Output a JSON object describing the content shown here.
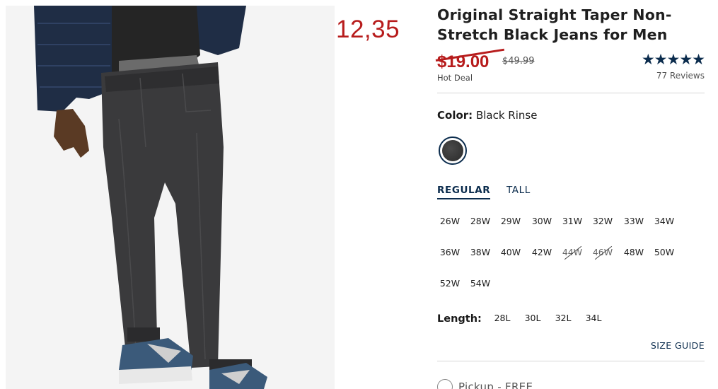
{
  "promo_price": "12,35",
  "product": {
    "title": "Original Straight Taper Non-Stretch Black Jeans for Men",
    "sale_price": "$19.00",
    "original_price": "$49.99",
    "deal_label": "Hot Deal",
    "rating_stars": "★★★★★",
    "reviews": "77 Reviews"
  },
  "color": {
    "label": "Color:",
    "value": "Black Rinse",
    "swatch_color": "#3a3a3a"
  },
  "fit_tabs": [
    {
      "label": "REGULAR",
      "active": true
    },
    {
      "label": "TALL",
      "active": false
    }
  ],
  "waist_sizes": [
    {
      "label": "26W",
      "available": true
    },
    {
      "label": "28W",
      "available": true
    },
    {
      "label": "29W",
      "available": true
    },
    {
      "label": "30W",
      "available": true
    },
    {
      "label": "31W",
      "available": true
    },
    {
      "label": "32W",
      "available": true
    },
    {
      "label": "33W",
      "available": true
    },
    {
      "label": "34W",
      "available": true
    },
    {
      "label": "36W",
      "available": true
    },
    {
      "label": "38W",
      "available": true
    },
    {
      "label": "40W",
      "available": true
    },
    {
      "label": "42W",
      "available": true
    },
    {
      "label": "44W",
      "available": false
    },
    {
      "label": "46W",
      "available": false
    },
    {
      "label": "48W",
      "available": true
    },
    {
      "label": "50W",
      "available": true
    },
    {
      "label": "52W",
      "available": true
    },
    {
      "label": "54W",
      "available": true
    }
  ],
  "length": {
    "label": "Length:",
    "options": [
      "28L",
      "30L",
      "32L",
      "34L"
    ]
  },
  "size_guide": "SIZE GUIDE",
  "pickup": "Pickup - FREE",
  "colors": {
    "sale_red": "#b71c1c",
    "navy": "#0b2c4d"
  }
}
